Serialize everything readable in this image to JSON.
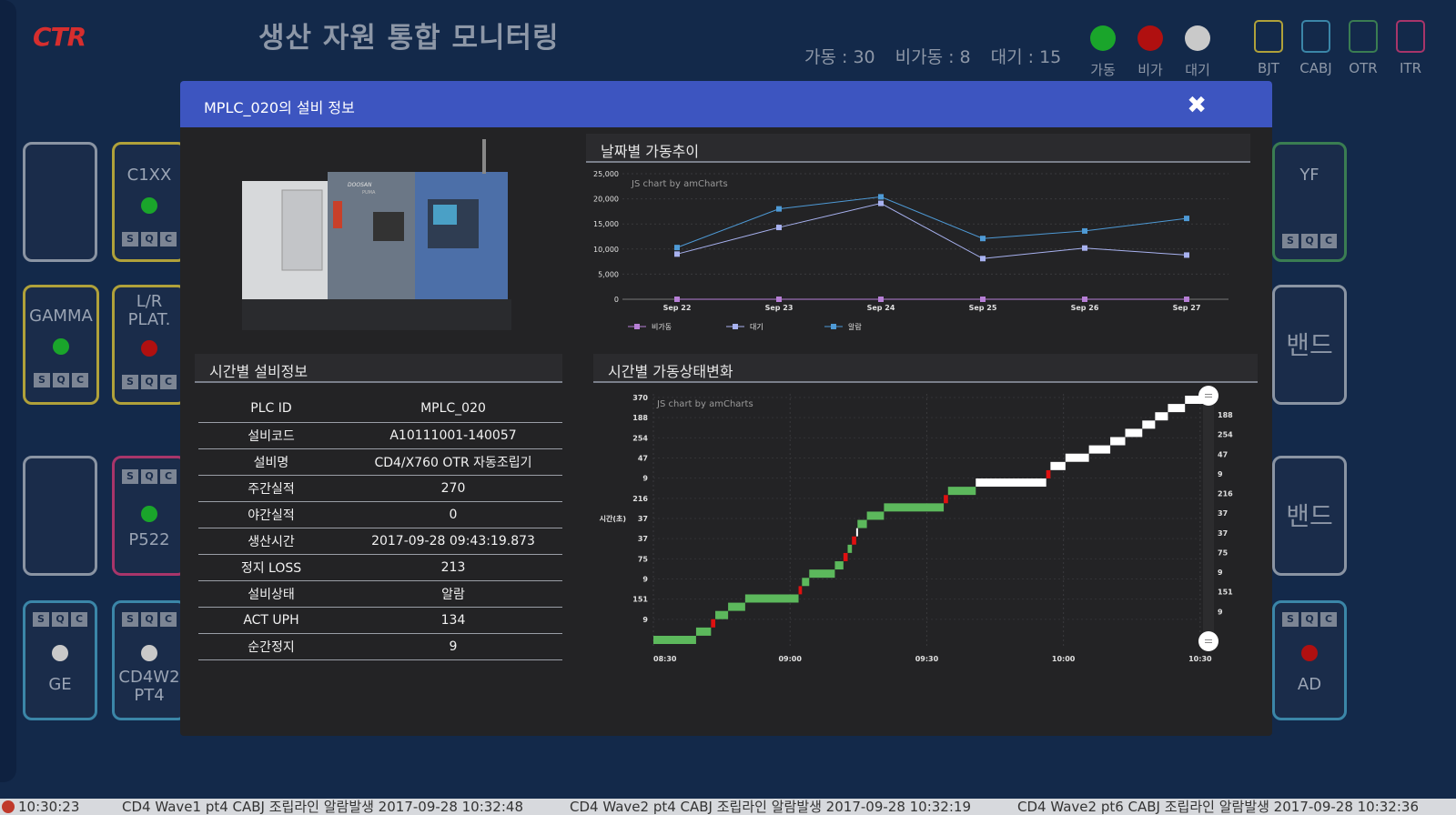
{
  "header": {
    "logo": "CTR",
    "title": "생산 자원 통합 모니터링",
    "counts": {
      "running": "가동 : 30",
      "stopped": "비가동 : 8",
      "idle": "대기 : 15"
    },
    "legend": [
      {
        "label": "가동",
        "color": "#1aa52b"
      },
      {
        "label": "비가동",
        "color": "#b01010"
      },
      {
        "label": "대기",
        "color": "#c9c9c9"
      }
    ],
    "categories": [
      {
        "label": "BJT",
        "color": "#b0a13a"
      },
      {
        "label": "CABJ",
        "color": "#3b86a8"
      },
      {
        "label": "OTR",
        "color": "#3a7d52"
      },
      {
        "label": "ITR",
        "color": "#a8356a"
      }
    ]
  },
  "tiles": {
    "c1xx": "C1XX",
    "gamma": "GAMMA",
    "lrplat": "L/R\nPLAT.",
    "p522": "P522",
    "ge": "GE",
    "cd4w2": "CD4W2\nPT4",
    "yf": "YF",
    "band1": "밴드",
    "band2": "밴드",
    "ad": "AD",
    "s": "S",
    "q": "Q",
    "c": "C"
  },
  "modal": {
    "title": "MPLC_020의 설비 정보",
    "close": "✖",
    "machine_brand": "DOOSAN",
    "machine_model": "PUMA",
    "info_title": "시간별 설비정보",
    "info_rows": [
      {
        "k": "PLC ID",
        "v": "MPLC_020"
      },
      {
        "k": "설비코드",
        "v": "A10111001-140057"
      },
      {
        "k": "설비명",
        "v": "CD4/X760 OTR 자동조립기"
      },
      {
        "k": "주간실적",
        "v": "270"
      },
      {
        "k": "야간실적",
        "v": "0"
      },
      {
        "k": "생산시간",
        "v": "2017-09-28 09:43:19.873"
      },
      {
        "k": "정지 LOSS",
        "v": "213"
      },
      {
        "k": "설비상태",
        "v": "알람"
      },
      {
        "k": "ACT UPH",
        "v": "134"
      },
      {
        "k": "순간정지",
        "v": "9"
      }
    ],
    "daily_title": "날짜별 가동추이",
    "timeline_title": "시간별 가동상태변화"
  },
  "chart_data": [
    {
      "type": "line",
      "title": "날짜별 가동추이",
      "watermark": "JS chart by amCharts",
      "categories": [
        "Sep 22",
        "Sep 23",
        "Sep 24",
        "Sep 25",
        "Sep 26",
        "Sep 27"
      ],
      "y_ticks": [
        "0",
        "5,000",
        "10,000",
        "15,000",
        "20,000",
        "25,000"
      ],
      "ylim": [
        0,
        25000
      ],
      "legend_position": "bottom-left",
      "series": [
        {
          "name": "비가동",
          "color": "#b77fd6",
          "values": [
            0,
            0,
            0,
            0,
            0,
            0
          ]
        },
        {
          "name": "대기",
          "color": "#a8b2f0",
          "values": [
            9000,
            14300,
            19100,
            8100,
            10200,
            8800
          ]
        },
        {
          "name": "알람",
          "color": "#4e9ad6",
          "values": [
            10300,
            18000,
            20400,
            12100,
            13600,
            16100
          ]
        }
      ]
    },
    {
      "type": "timeline",
      "title": "시간별 가동상태변화",
      "watermark": "JS chart by amCharts",
      "ylabel": "시간(초)",
      "x_ticks": [
        "08:30",
        "09:00",
        "09:30",
        "10:00",
        "10:30"
      ],
      "left_y_ticks": [
        "370",
        "188",
        "254",
        "47",
        "9",
        "216",
        "37",
        "37",
        "75",
        "9",
        "151",
        "9"
      ],
      "right_y_ticks": [
        "188",
        "254",
        "47",
        "9",
        "216",
        "37",
        "37",
        "75",
        "9",
        "151",
        "9"
      ],
      "status_colors": {
        "running": "#5cb85c",
        "stop": "#e01010",
        "idle": "#ffffff"
      },
      "segments": [
        {
          "start": 0.0,
          "end": 0.1,
          "level": 0,
          "status": "running"
        },
        {
          "start": 0.1,
          "end": 0.135,
          "level": 1,
          "status": "running"
        },
        {
          "start": 0.135,
          "end": 0.145,
          "level": 2,
          "status": "stop"
        },
        {
          "start": 0.145,
          "end": 0.175,
          "level": 3,
          "status": "running"
        },
        {
          "start": 0.175,
          "end": 0.215,
          "level": 4,
          "status": "running"
        },
        {
          "start": 0.215,
          "end": 0.34,
          "level": 5,
          "status": "running"
        },
        {
          "start": 0.34,
          "end": 0.348,
          "level": 6,
          "status": "stop"
        },
        {
          "start": 0.348,
          "end": 0.365,
          "level": 7,
          "status": "running"
        },
        {
          "start": 0.365,
          "end": 0.425,
          "level": 8,
          "status": "running"
        },
        {
          "start": 0.425,
          "end": 0.445,
          "level": 9,
          "status": "running"
        },
        {
          "start": 0.445,
          "end": 0.455,
          "level": 10,
          "status": "stop"
        },
        {
          "start": 0.455,
          "end": 0.465,
          "level": 11,
          "status": "running"
        },
        {
          "start": 0.465,
          "end": 0.475,
          "level": 12,
          "status": "stop"
        },
        {
          "start": 0.475,
          "end": 0.478,
          "level": 13,
          "status": "idle"
        },
        {
          "start": 0.478,
          "end": 0.5,
          "level": 14,
          "status": "running"
        },
        {
          "start": 0.5,
          "end": 0.54,
          "level": 15,
          "status": "running"
        },
        {
          "start": 0.54,
          "end": 0.68,
          "level": 16,
          "status": "running"
        },
        {
          "start": 0.68,
          "end": 0.69,
          "level": 17,
          "status": "stop"
        },
        {
          "start": 0.69,
          "end": 0.755,
          "level": 18,
          "status": "running"
        },
        {
          "start": 0.755,
          "end": 0.92,
          "level": 19,
          "status": "idle"
        },
        {
          "start": 0.92,
          "end": 0.93,
          "level": 20,
          "status": "stop"
        },
        {
          "start": 0.93,
          "end": 0.965,
          "level": 21,
          "status": "idle"
        },
        {
          "start": 0.965,
          "end": 1.02,
          "level": 22,
          "status": "idle"
        },
        {
          "start": 1.02,
          "end": 1.07,
          "level": 23,
          "status": "idle"
        },
        {
          "start": 1.07,
          "end": 1.105,
          "level": 24,
          "status": "idle"
        },
        {
          "start": 1.105,
          "end": 1.145,
          "level": 25,
          "status": "idle"
        },
        {
          "start": 1.145,
          "end": 1.175,
          "level": 26,
          "status": "idle"
        },
        {
          "start": 1.175,
          "end": 1.205,
          "level": 27,
          "status": "idle"
        },
        {
          "start": 1.205,
          "end": 1.245,
          "level": 28,
          "status": "idle"
        },
        {
          "start": 1.245,
          "end": 1.3,
          "level": 29,
          "status": "idle"
        }
      ]
    }
  ],
  "ticker": {
    "time": "10:30:23",
    "m1": "CD4 Wave1 pt4 CABJ 조립라인 알람발생 2017-09-28 10:32:48",
    "m2": "CD4 Wave2 pt4 CABJ 조립라인 알람발생 2017-09-28 10:32:19",
    "m3": "CD4 Wave2 pt6 CABJ 조립라인 알람발생 2017-09-28 10:32:36"
  }
}
